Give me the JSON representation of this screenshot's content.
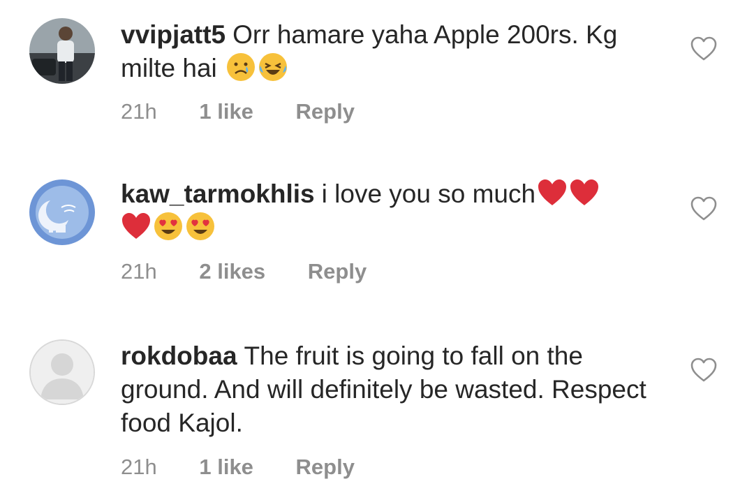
{
  "comments": [
    {
      "username": "vvipjatt5",
      "text": "Orr hamare yaha Apple 200rs. Kg milte hai",
      "emojis": [
        "crying-face",
        "laughing-tears-face"
      ],
      "time": "21h",
      "likes": "1 like",
      "reply": "Reply",
      "avatar": "person-photo"
    },
    {
      "username": "kaw_tarmokhlis",
      "text": "i love you so much",
      "emojis": [
        "red-heart",
        "red-heart",
        "red-heart",
        "heart-eyes-face",
        "heart-eyes-face"
      ],
      "time": "21h",
      "likes": "2 likes",
      "reply": "Reply",
      "avatar": "blue-crescent-mosque-art"
    },
    {
      "username": "rokdobaa",
      "text": "The fruit is going to fall on the ground. And will definitely be wasted. Respect food Kajol.",
      "time": "21h",
      "likes": "1 like",
      "reply": "Reply",
      "avatar": "default-profile-placeholder"
    }
  ],
  "colors": {
    "text": "#262626",
    "meta": "#8e8e8e",
    "heart_outline": "#8e8e8e"
  }
}
